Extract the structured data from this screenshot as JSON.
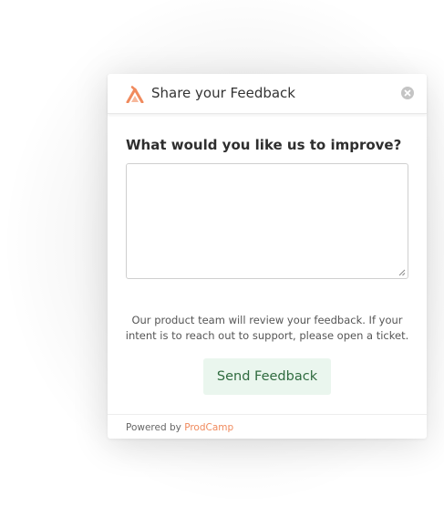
{
  "colors": {
    "brand_accent": "#f08a5d",
    "send_button_bg": "#eaf6ee",
    "send_button_text": "#2f6b3f"
  },
  "header": {
    "logo_icon": "prodcamp-logo-icon",
    "title": "Share your Feedback",
    "close_icon": "close-circle-icon"
  },
  "form": {
    "question": "What would you like us to improve?",
    "feedback_value": "",
    "feedback_placeholder": "",
    "info_text": "Our product team will review your feedback. If your intent is to reach out to support, please open a ticket.",
    "send_label": "Send Feedback"
  },
  "footer": {
    "powered_by": "Powered by",
    "brand_name": "ProdCamp"
  }
}
